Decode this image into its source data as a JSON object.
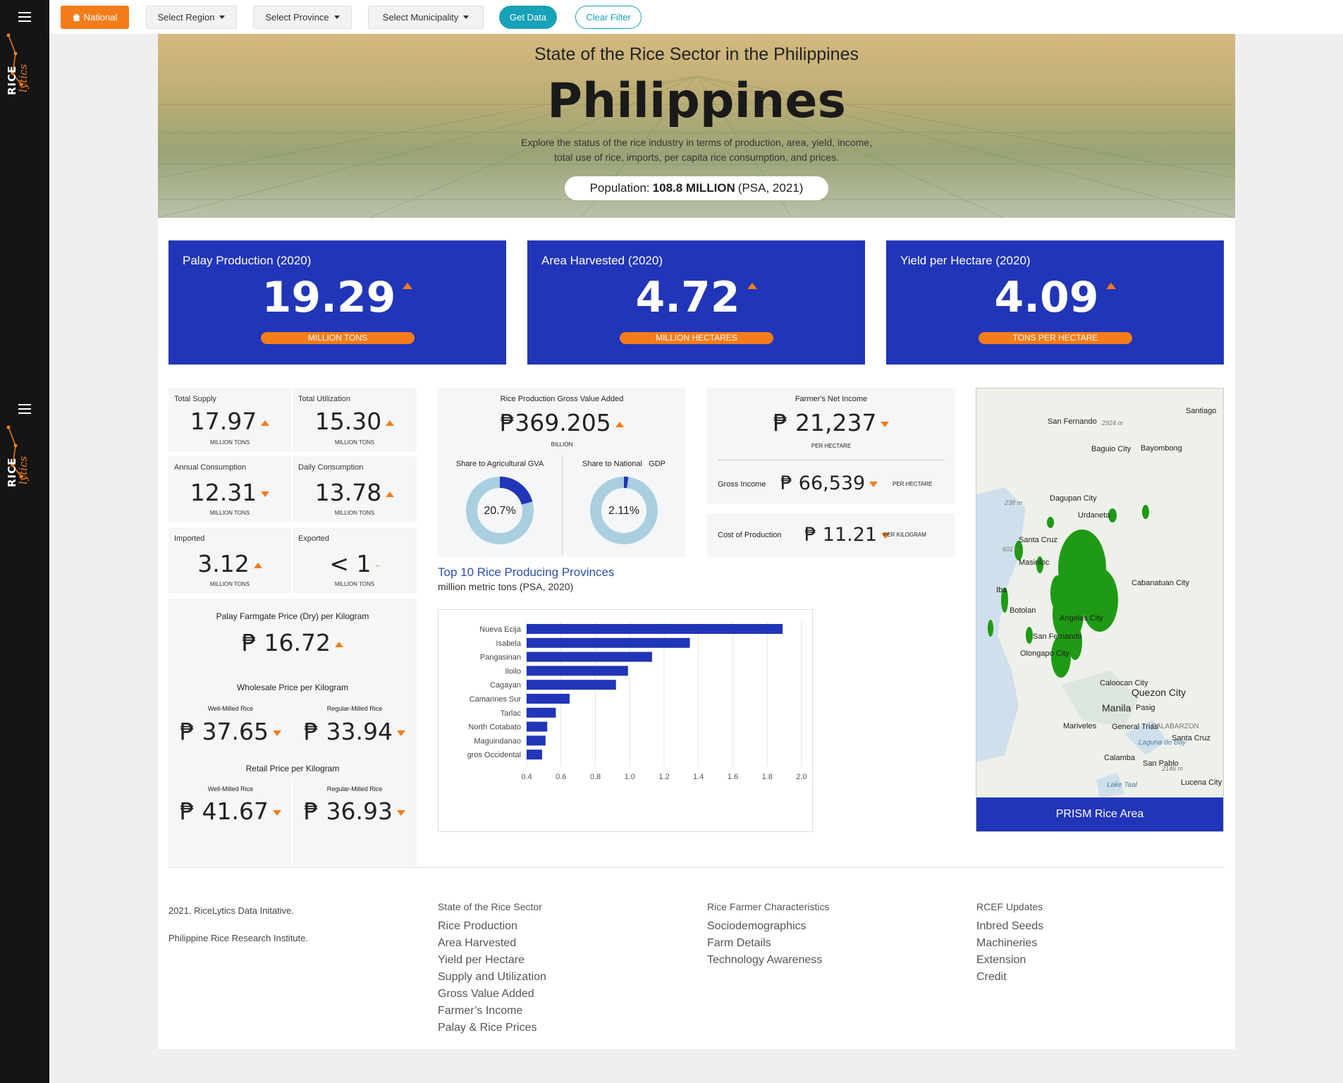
{
  "topbar": {
    "national": "National",
    "region": "Select Region",
    "province": "Select Province",
    "municipality": "Select Municipality",
    "get_data": "Get Data",
    "clear_filter": "Clear Filter"
  },
  "sidebar": {
    "logo_text": "RICE",
    "logo_script": "lytics"
  },
  "hero": {
    "subtitle": "State of the Rice Sector in the Philippines",
    "title": "Philippines",
    "description": "Explore the status of the rice industry in terms of production, area, yield, income, total use of rice, imports, per capita rice consumption, and prices.",
    "population_label": "Population:",
    "population_value": "108.8 MILLION",
    "population_source": "(PSA, 2021)"
  },
  "big_cards": [
    {
      "label": "Palay Production (2020)",
      "value": "19.29",
      "unit": "MILLION TONS",
      "trend": "up"
    },
    {
      "label": "Area Harvested (2020)",
      "value": "4.72",
      "unit": "MILLION HECTARES",
      "trend": "up"
    },
    {
      "label": "Yield per Hectare (2020)",
      "value": "4.09",
      "unit": "TONS PER HECTARE",
      "trend": "up"
    }
  ],
  "tiles": [
    {
      "label": "Total Supply",
      "value": "17.97",
      "unit": "MILLION TONS",
      "trend": "up"
    },
    {
      "label": "Total Utilization",
      "value": "15.30",
      "unit": "MILLION TONS",
      "trend": "up"
    },
    {
      "label": "Annual Consumption",
      "value": "12.31",
      "unit": "MILLION TONS",
      "trend": "down"
    },
    {
      "label": "Daily Consumption",
      "value": "13.78",
      "unit": "MILLION TONS",
      "trend": "up"
    },
    {
      "label": "Imported",
      "value": "3.12",
      "unit": "MILLION TONS",
      "trend": "up"
    },
    {
      "label": "Exported",
      "value": "< 1",
      "unit": "MILLION TONS",
      "trend": "flat"
    }
  ],
  "prices": {
    "farmgate_label": "Palay Farmgate Price (Dry) per Kilogram",
    "farmgate_value": "₱ 16.72",
    "wholesale_label": "Wholesale Price per Kilogram",
    "retail_label": "Retail Price per Kilogram",
    "well_milled": "Well-Milled Rice",
    "regular_milled": "Regular-Milled Rice",
    "wholesale_well": "₱ 37.65",
    "wholesale_regular": "₱ 33.94",
    "retail_well": "₱ 41.67",
    "retail_regular": "₱ 36.93"
  },
  "gva": {
    "label": "Rice Production Gross Value Added",
    "value": "₱369.205",
    "unit": "BILLION",
    "share_agri_label": "Share to Agricultural GVA",
    "share_agri_value": "20.7%",
    "share_agri_pct": 20.7,
    "share_gdp_label": "Share to National",
    "share_gdp_label2": "GDP",
    "share_gdp_value": "2.11%",
    "share_gdp_pct": 2.11
  },
  "income": {
    "net_label": "Farmer's Net Income",
    "net_value": "₱ 21,237",
    "net_unit": "PER HECTARE",
    "gross_label": "Gross Income",
    "gross_value": "₱ 66,539",
    "gross_unit": "PER HECTARE",
    "cost_label": "Cost of Production",
    "cost_value": "₱ 11.21",
    "cost_unit": "PER KILOGRAM"
  },
  "chart_data": {
    "type": "bar",
    "title": "Top 10 Rice Producing Provinces",
    "subtitle": "million metric tons (PSA, 2020)",
    "categories": [
      "Nueva Ecija",
      "Isabela",
      "Pangasinan",
      "Iloilo",
      "Cagayan",
      "Camarines Sur",
      "Tarlac",
      "North Cotabato",
      "Maguindanao",
      "gros Occidental"
    ],
    "values": [
      1.89,
      1.35,
      1.13,
      0.99,
      0.92,
      0.65,
      0.57,
      0.52,
      0.51,
      0.49
    ],
    "xlim": [
      0.4,
      2.0
    ],
    "xticks": [
      "0.4",
      "0.6",
      "0.8",
      "1.0",
      "1.2",
      "1.4",
      "1.6",
      "1.8",
      "2.0"
    ],
    "color": "#2135b8",
    "grid": true
  },
  "map": {
    "button": "PRISM Rice Area",
    "labels": [
      "San Fernando",
      "Santiago",
      "Baguio City",
      "Bayombong",
      "Dagupan City",
      "Urdaneta",
      "Santa Cruz",
      "Masinloc",
      "Iba",
      "Botolan",
      "Cabanatuan City",
      "Angeles City",
      "San Fernando",
      "Olongapo City",
      "Caloocan City",
      "Quezon City",
      "Manila",
      "Pasig",
      "Mariveles",
      "General Trias",
      "CALABARZON",
      "Laguna de Bay",
      "Santa Cruz",
      "Calamba",
      "San Pablo",
      "Lake Taal",
      "Lucena City",
      "2924 m",
      "238 m",
      "601 m",
      "2146 m"
    ]
  },
  "footer": {
    "copyright": "2021. RiceLytics Data Initative.",
    "institute": "Philippine Rice Research Institute.",
    "col1_head": "State of the Rice Sector",
    "col1_links": [
      "Rice Production",
      "Area Harvested",
      "Yield per Hectare",
      "Supply and Utilization",
      "Gross Value Added",
      "Farmer’s Income",
      "Palay & Rice Prices"
    ],
    "col2_head": "Rice Farmer Characteristics",
    "col2_links": [
      "Sociodemographics",
      "Farm Details",
      "Technology Awareness"
    ],
    "col3_head": "RCEF Updates",
    "col3_links": [
      "Inbred Seeds",
      "Machineries",
      "Extension",
      "Credit"
    ]
  },
  "colors": {
    "accent": "#f47c1a",
    "primary": "#2135b8",
    "teal": "#17a2b8",
    "donut_bg": "#a9cfe0"
  }
}
